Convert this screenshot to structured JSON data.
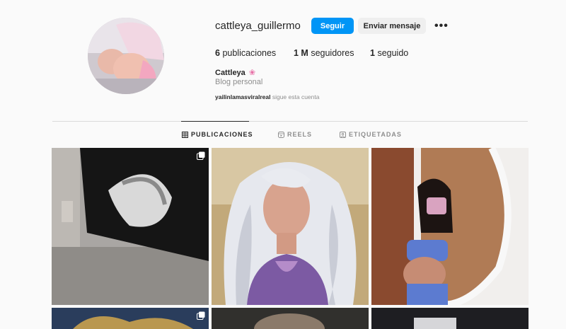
{
  "profile": {
    "username": "cattleya_guillermo",
    "follow_label": "Seguir",
    "message_label": "Enviar mensaje",
    "more_label": "•••",
    "posts_count": "6",
    "posts_label": "publicaciones",
    "followers_count": "1 M",
    "followers_label": "seguidores",
    "following_count": "1",
    "following_label": "seguido",
    "full_name": "Cattleya",
    "name_emoji": "❀",
    "category": "Blog personal",
    "followed_by_user": "yailinlamasviralreal",
    "followed_by_text": "sigue esta cuenta"
  },
  "tabs": [
    {
      "label": "PUBLICACIONES",
      "icon": "grid-icon",
      "active": true
    },
    {
      "label": "REELS",
      "icon": "reels-icon",
      "active": false
    },
    {
      "label": "ETIQUETADAS",
      "icon": "tagged-icon",
      "active": false
    }
  ],
  "colors": {
    "primary_button": "#0095f6",
    "secondary_button": "#efefef",
    "background": "#fafafa"
  },
  "posts": [
    {
      "icon": "multiple-posts-icon"
    },
    {
      "icon": "none"
    },
    {
      "icon": "none"
    },
    {
      "icon": "multiple-posts-icon"
    },
    {
      "icon": "none"
    },
    {
      "icon": "none"
    }
  ]
}
